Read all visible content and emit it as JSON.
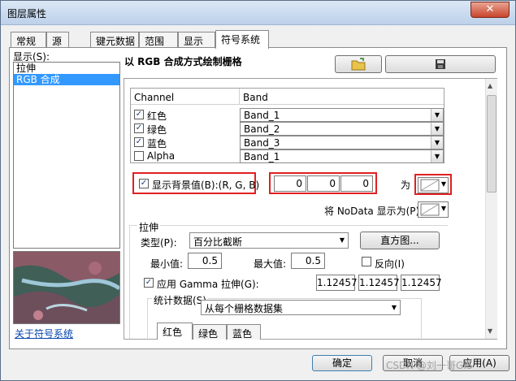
{
  "window": {
    "title": "图层属性",
    "close_label": "✕"
  },
  "tabs": [
    "常规",
    "源",
    "键元数据",
    "范围",
    "显示",
    "符号系统"
  ],
  "left": {
    "show_label": "显示(S):",
    "items": [
      "拉伸",
      "RGB 合成"
    ],
    "about_link": "关于符号系统"
  },
  "header": {
    "title": "以 RGB 合成方式绘制栅格"
  },
  "table": {
    "col_channel": "Channel",
    "col_band": "Band",
    "rows": [
      {
        "checked": true,
        "channel": "红色",
        "band": "Band_1"
      },
      {
        "checked": true,
        "channel": "绿色",
        "band": "Band_2"
      },
      {
        "checked": true,
        "channel": "蓝色",
        "band": "Band_3"
      },
      {
        "checked": false,
        "channel": "Alpha",
        "band": "Band_1"
      }
    ]
  },
  "background": {
    "label": "显示背景值(B):(R, G, B)",
    "checked": true,
    "r": "0",
    "g": "0",
    "b": "0",
    "as_label": "为"
  },
  "nodata": {
    "label": "将 NoData 显示为(P)"
  },
  "stretch": {
    "group_label": "拉伸",
    "type_label": "类型(P):",
    "type_value": "百分比截断",
    "histogram_button": "直方图...",
    "min_label": "最小值:",
    "min_value": "0.5",
    "max_label": "最大值:",
    "max_value": "0.5",
    "invert_label": "反向(I)",
    "gamma_label": "应用 Gamma 拉伸(G):",
    "gamma_checked": true,
    "gamma_values": [
      "1.12457",
      "1.12457",
      "1.12457"
    ]
  },
  "stats": {
    "label": "统计数据(S)",
    "value": "从每个栅格数据集",
    "subtabs": [
      "红色",
      "绿色",
      "蓝色"
    ]
  },
  "buttons": {
    "ok": "确定",
    "cancel": "取消",
    "apply": "应用(A)"
  },
  "watermark": "CSDN @刘一哥GIS"
}
